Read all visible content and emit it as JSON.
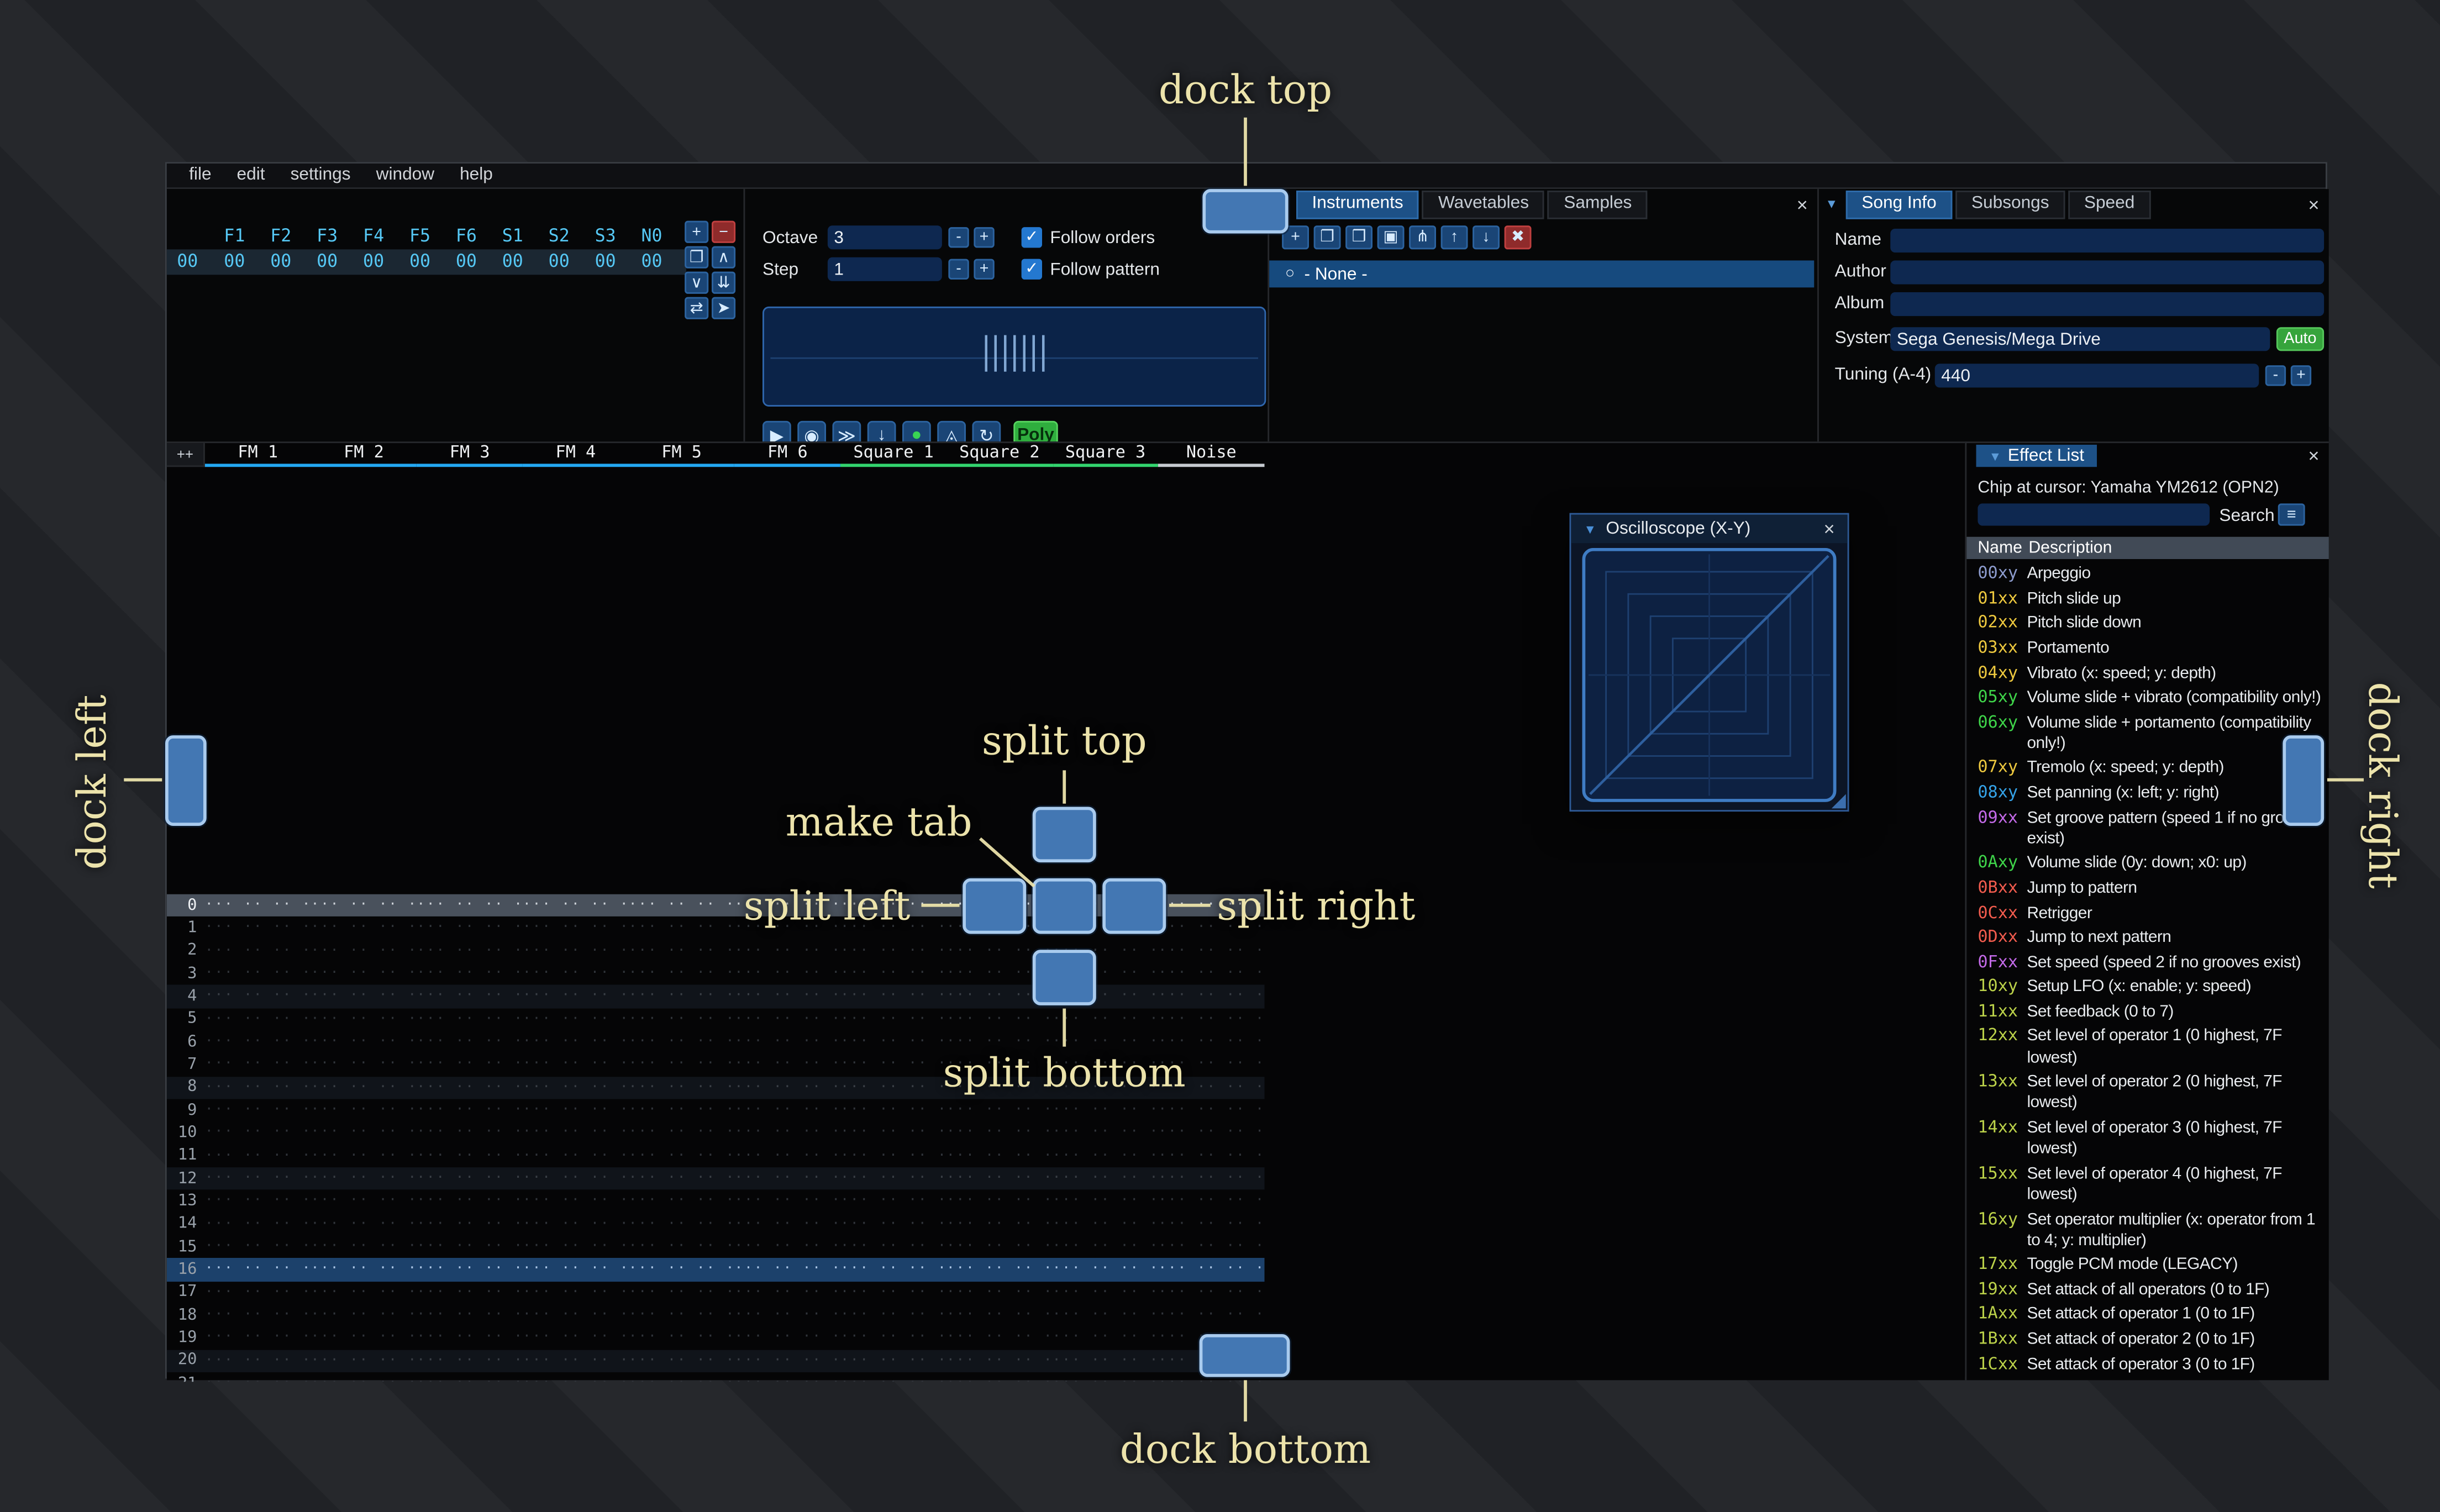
{
  "window": {
    "menu_items": [
      "file",
      "edit",
      "settings",
      "window",
      "help"
    ]
  },
  "orders": {
    "columns": [
      "F1",
      "F2",
      "F3",
      "F4",
      "F5",
      "F6",
      "S1",
      "S2",
      "S3",
      "N0"
    ],
    "row_label": "00",
    "row_values": [
      "00",
      "00",
      "00",
      "00",
      "00",
      "00",
      "00",
      "00",
      "00",
      "00"
    ],
    "toolbar": [
      {
        "name": "add-order-button",
        "glyph": "+",
        "variant": "blue"
      },
      {
        "name": "remove-order-button",
        "glyph": "−",
        "variant": "red"
      },
      {
        "name": "duplicate-order-button",
        "glyph": "❐",
        "variant": "blue"
      },
      {
        "name": "move-order-up-button",
        "glyph": "∧",
        "variant": "blue"
      },
      {
        "name": "move-order-down-button",
        "glyph": "∨",
        "variant": "blue"
      },
      {
        "name": "duplicate-order-end-button",
        "glyph": "⇊",
        "variant": "blue"
      },
      {
        "name": "order-change-mode-button",
        "glyph": "⇄",
        "variant": "blue"
      },
      {
        "name": "order-edit-mode-button",
        "glyph": "➤",
        "variant": "blue"
      }
    ]
  },
  "transport": {
    "octave_label": "Octave",
    "octave_value": "3",
    "step_label": "Step",
    "step_value": "1",
    "minus_label": "-",
    "plus_label": "+",
    "follow_orders_label": "Follow orders",
    "follow_pattern_label": "Follow pattern",
    "check_glyph": "✓",
    "buttons": [
      {
        "name": "play-button",
        "glyph": "▶"
      },
      {
        "name": "play-pattern-button",
        "glyph": "◉"
      },
      {
        "name": "play-from-cursor-button",
        "glyph": "≫"
      },
      {
        "name": "step-one-row-button",
        "glyph": "↓"
      },
      {
        "name": "record-button",
        "glyph": "●",
        "green": true
      },
      {
        "name": "metronome-button",
        "glyph": "◬"
      },
      {
        "name": "repeat-pattern-button",
        "glyph": "↻"
      }
    ],
    "poly_label": "Poly"
  },
  "assets": {
    "tabs": [
      "Instruments",
      "Wavetables",
      "Samples"
    ],
    "selected_tab": "Instruments",
    "toolbar": [
      {
        "name": "add-instrument-button",
        "glyph": "+",
        "variant": "blue"
      },
      {
        "name": "duplicate-instrument-button",
        "glyph": "❐",
        "variant": "blue"
      },
      {
        "name": "open-instrument-button",
        "glyph": "❒",
        "variant": "blue"
      },
      {
        "name": "save-instrument-button",
        "glyph": "▣",
        "variant": "blue"
      },
      {
        "name": "instrument-folder-button",
        "glyph": "⋔",
        "variant": "blue"
      },
      {
        "name": "move-instrument-up-button",
        "glyph": "↑",
        "variant": "blue"
      },
      {
        "name": "move-instrument-down-button",
        "glyph": "↓",
        "variant": "blue"
      },
      {
        "name": "delete-instrument-button",
        "glyph": "✖",
        "variant": "red"
      }
    ],
    "radio_glyph": "○",
    "list_item": "- None -"
  },
  "song_info": {
    "tabs": [
      "Song Info",
      "Subsongs",
      "Speed"
    ],
    "selected_tab": "Song Info",
    "name_label": "Name",
    "author_label": "Author",
    "album_label": "Album",
    "system_label": "System",
    "system_value": "Sega Genesis/Mega Drive",
    "auto_label": "Auto",
    "tuning_label": "Tuning (A-4)",
    "tuning_value": "440",
    "minus_label": "-",
    "plus_label": "+"
  },
  "oscilloscope": {
    "title": "Oscilloscope (X-Y)"
  },
  "pattern": {
    "corner_label": "++",
    "channels": [
      {
        "name": "FM 1",
        "color": "#24a8f2"
      },
      {
        "name": "FM 2",
        "color": "#24a8f2"
      },
      {
        "name": "FM 3",
        "color": "#24a8f2"
      },
      {
        "name": "FM 4",
        "color": "#24a8f2"
      },
      {
        "name": "FM 5",
        "color": "#24a8f2"
      },
      {
        "name": "FM 6",
        "color": "#24a8f2"
      },
      {
        "name": "Square 1",
        "color": "#33d46e"
      },
      {
        "name": "Square 2",
        "color": "#33d46e"
      },
      {
        "name": "Square 3",
        "color": "#33d46e"
      },
      {
        "name": "Noise",
        "color": "#c6cad0"
      }
    ],
    "row_count": 22,
    "cursor_row": 0,
    "playhead_row": 16,
    "highlight_every": 4,
    "cell_placeholder": "··· ·· ·· ···"
  },
  "effect_list": {
    "title": "Effect List",
    "chip_line": "Chip at cursor: Yamaha YM2612 (OPN2)",
    "search_label": "Search",
    "name_header": "Name",
    "description_header": "Description",
    "effects": [
      {
        "code": "00xy",
        "color": "#8d9cce",
        "description": "Arpeggio"
      },
      {
        "code": "01xx",
        "color": "#eec93f",
        "description": "Pitch slide up"
      },
      {
        "code": "02xx",
        "color": "#eec93f",
        "description": "Pitch slide down"
      },
      {
        "code": "03xx",
        "color": "#eec93f",
        "description": "Portamento"
      },
      {
        "code": "04xy",
        "color": "#eec93f",
        "description": "Vibrato (x: speed; y: depth)"
      },
      {
        "code": "05xy",
        "color": "#3fd54a",
        "description": "Volume slide + vibrato (compatibility only!)"
      },
      {
        "code": "06xy",
        "color": "#3fd54a",
        "description": "Volume slide + portamento (compatibility only!)"
      },
      {
        "code": "07xy",
        "color": "#eec93f",
        "description": "Tremolo (x: speed; y: depth)"
      },
      {
        "code": "08xy",
        "color": "#35a3e8",
        "description": "Set panning (x: left; y: right)"
      },
      {
        "code": "09xx",
        "color": "#c36ae8",
        "description": "Set groove pattern (speed 1 if no grooves exist)"
      },
      {
        "code": "0Axy",
        "color": "#3fd54a",
        "description": "Volume slide (0y: down; x0: up)"
      },
      {
        "code": "0Bxx",
        "color": "#f25c4e",
        "description": "Jump to pattern"
      },
      {
        "code": "0Cxx",
        "color": "#f25c4e",
        "description": "Retrigger"
      },
      {
        "code": "0Dxx",
        "color": "#f25c4e",
        "description": "Jump to next pattern"
      },
      {
        "code": "0Fxx",
        "color": "#c36ae8",
        "description": "Set speed (speed 2 if no grooves exist)"
      },
      {
        "code": "10xy",
        "color": "#bcd24a",
        "description": "Setup LFO (x: enable; y: speed)"
      },
      {
        "code": "11xx",
        "color": "#bcd24a",
        "description": "Set feedback (0 to 7)"
      },
      {
        "code": "12xx",
        "color": "#bcd24a",
        "description": "Set level of operator 1 (0 highest, 7F lowest)"
      },
      {
        "code": "13xx",
        "color": "#bcd24a",
        "description": "Set level of operator 2 (0 highest, 7F lowest)"
      },
      {
        "code": "14xx",
        "color": "#bcd24a",
        "description": "Set level of operator 3 (0 highest, 7F lowest)"
      },
      {
        "code": "15xx",
        "color": "#bcd24a",
        "description": "Set level of operator 4 (0 highest, 7F lowest)"
      },
      {
        "code": "16xy",
        "color": "#bcd24a",
        "description": "Set operator multiplier (x: operator from 1 to 4; y: multiplier)"
      },
      {
        "code": "17xx",
        "color": "#bcd24a",
        "description": "Toggle PCM mode (LEGACY)"
      },
      {
        "code": "19xx",
        "color": "#bcd24a",
        "description": "Set attack of all operators (0 to 1F)"
      },
      {
        "code": "1Axx",
        "color": "#bcd24a",
        "description": "Set attack of operator 1 (0 to 1F)"
      },
      {
        "code": "1Bxx",
        "color": "#bcd24a",
        "description": "Set attack of operator 2 (0 to 1F)"
      },
      {
        "code": "1Cxx",
        "color": "#bcd24a",
        "description": "Set attack of operator 3 (0 to 1F)"
      }
    ]
  },
  "dock_overlay": {
    "dock_top": "dock top",
    "dock_left": "dock left",
    "dock_right": "dock right",
    "dock_bottom": "dock bottom",
    "split_top": "split top",
    "split_left": "split left",
    "split_right": "split right",
    "split_bottom": "split bottom",
    "make_tab": "make tab"
  }
}
